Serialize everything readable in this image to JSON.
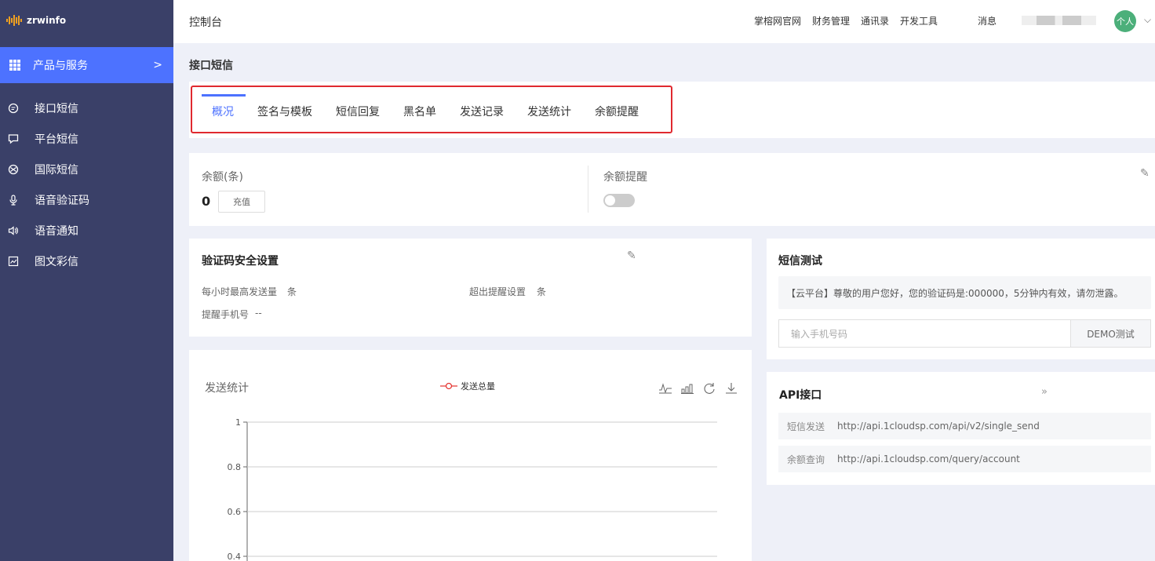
{
  "brand": {
    "name": "zrwinfo"
  },
  "sidebar": {
    "active": {
      "label": "产品与服务",
      "chevron": "chevron-right-icon"
    },
    "items": [
      {
        "label": "接口短信",
        "icon": "chat-bubble-icon"
      },
      {
        "label": "平台短信",
        "icon": "message-square-icon"
      },
      {
        "label": "国际短信",
        "icon": "globe-icon"
      },
      {
        "label": "语音验证码",
        "icon": "microphone-icon"
      },
      {
        "label": "语音通知",
        "icon": "speaker-icon"
      },
      {
        "label": "图文彩信",
        "icon": "image-chart-icon"
      }
    ]
  },
  "header": {
    "title": "控制台",
    "nav": [
      "掌榕网官网",
      "财务管理",
      "通讯录",
      "开发工具"
    ],
    "message": "消息",
    "avatar": "个人"
  },
  "breadcrumb": "接口短信",
  "tabs": [
    "概况",
    "签名与模板",
    "短信回复",
    "黑名单",
    "发送记录",
    "发送统计",
    "余额提醒"
  ],
  "balance": {
    "label": "余额(条)",
    "value": "0",
    "recharge": "充值",
    "remind_label": "余额提醒",
    "remind_on": false
  },
  "verify": {
    "title": "验证码安全设置",
    "max_per_hour_label": "每小时最高发送量",
    "max_per_hour_unit": "条",
    "over_remind_label": "超出提醒设置",
    "over_remind_unit": "条",
    "phone_label": "提醒手机号",
    "phone_value": "--"
  },
  "sms_test": {
    "title": "短信测试",
    "message": "【云平台】尊敬的用户您好，您的验证码是:000000，5分钟内有效，请勿泄露。",
    "input_placeholder": "输入手机号码",
    "demo_button": "DEMO测试"
  },
  "stats": {
    "title": "发送统计",
    "legend": "发送总量",
    "tools": [
      "line-chart-icon",
      "bar-chart-icon",
      "refresh-icon",
      "download-icon"
    ]
  },
  "api": {
    "title": "API接口",
    "more_icon": "double-chevron-right-icon",
    "rows": [
      {
        "key": "短信发送",
        "url": "http://api.1cloudsp.com/api/v2/single_send"
      },
      {
        "key": "余额查询",
        "url": "http://api.1cloudsp.com/query/account"
      }
    ]
  },
  "colors": {
    "sidebar": "#3a4068",
    "accent": "#4d72ff",
    "highlight_box": "#e0292f",
    "legend_line": "#e53935"
  },
  "chart_data": {
    "type": "line",
    "title": "发送统计",
    "series": [
      {
        "name": "发送总量",
        "values": []
      }
    ],
    "ylim": [
      0,
      1
    ],
    "yticks": [
      "1",
      "0.8",
      "0.6",
      "0.4"
    ],
    "grid": true
  }
}
